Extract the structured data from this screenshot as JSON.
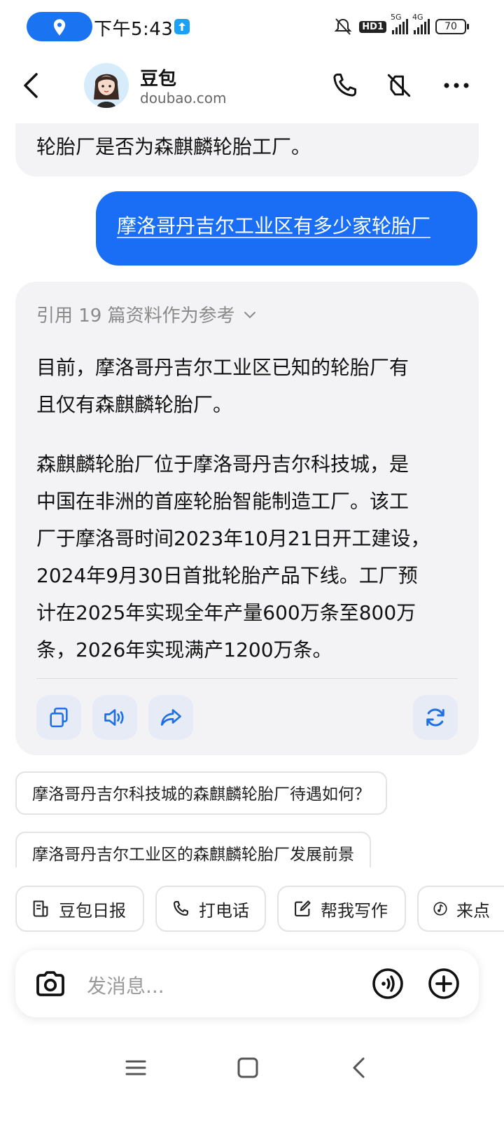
{
  "status_bar": {
    "time": "下午5:43",
    "hd_label": "HD1",
    "net1": "5G",
    "net2": "4G",
    "battery": "70"
  },
  "header": {
    "bot_name": "豆包",
    "bot_domain": "doubao.com"
  },
  "messages": {
    "prev_bot_tail": "轮胎厂是否为森麒麟轮胎工厂。",
    "user_question": "摩洛哥丹吉尔工业区有多少家轮胎厂",
    "references": "引用 19 篇资料作为参考",
    "answer_para1_line1": "目前，摩洛哥丹吉尔工业区已知的轮胎厂有",
    "answer_para1_line2": "且仅有森麒麟轮胎厂。",
    "answer_para2_lines": [
      "森麒麟轮胎厂位于摩洛哥丹吉尔科技城，是",
      "中国在非洲的首座轮胎智能制造工厂。该工",
      "厂于摩洛哥时间2023年10月21日开工建设，",
      "2024年9月30日首批轮胎产品下线。工厂预",
      "计在2025年实现全年产量600万条至800万",
      "条，2026年实现满产1200万条。"
    ]
  },
  "suggestions": [
    "摩洛哥丹吉尔科技城的森麒麟轮胎厂待遇如何？",
    "摩洛哥丹吉尔工业区的森麒麟轮胎厂发展前景"
  ],
  "chips": [
    "豆包日报",
    "打电话",
    "帮我写作",
    "来点"
  ],
  "input": {
    "placeholder": "发消息..."
  },
  "colors": {
    "accent": "#1a6ef5",
    "bubble_gray": "#f3f3f5",
    "icon_blue": "#1f6fe5"
  }
}
